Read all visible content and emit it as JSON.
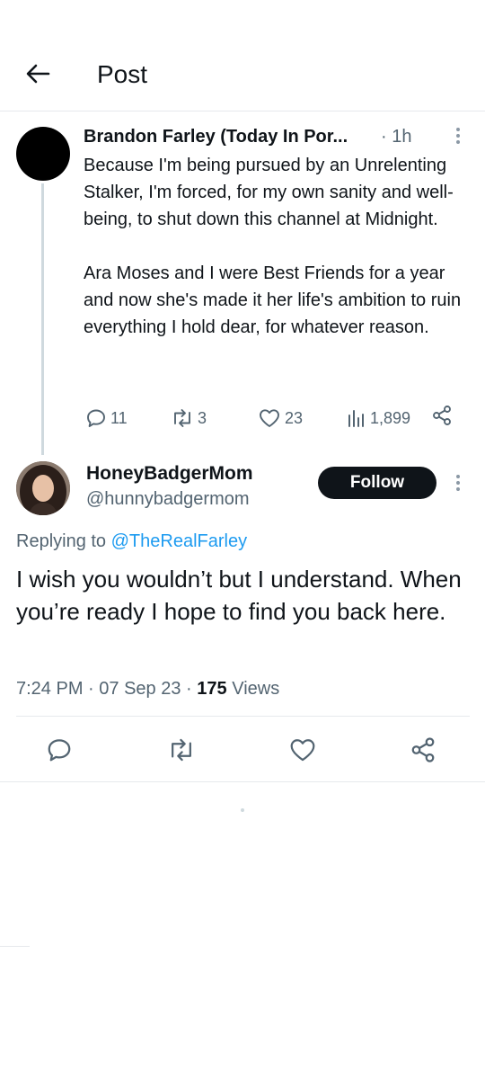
{
  "header": {
    "back_icon": "arrow-left-icon",
    "title": "Post"
  },
  "parent_post": {
    "author_name": "Brandon Farley (Today In Por...",
    "time": "· 1h",
    "paragraphs": [
      "Because I'm being pursued by an Unrelenting Stalker, I'm forced, for my own sanity and well-being, to shut down this channel at Midnight.",
      "Ara Moses and I were Best Friends for a year and now she's made it her life's ambition to ruin everything I hold dear, for whatever reason."
    ],
    "stats": {
      "replies": "11",
      "reposts": "3",
      "likes": "23",
      "views": "1,899"
    }
  },
  "reply_post": {
    "author_name": "HoneyBadgerMom",
    "handle": "@hunnybadgermom",
    "follow_label": "Follow",
    "replying_prefix": "Replying to",
    "replying_to": "@TheRealFarley",
    "text": "I wish you wouldn’t but I understand. When you’re ready I hope to find you back here.",
    "time": "7:24 PM",
    "date": "07 Sep 23",
    "views_count": "175",
    "views_label": "Views"
  },
  "colors": {
    "text_primary": "#0f1419",
    "text_secondary": "#536471",
    "link": "#1d9bf0",
    "divider": "#e6e9ec",
    "thread_line": "#cfd9de"
  }
}
